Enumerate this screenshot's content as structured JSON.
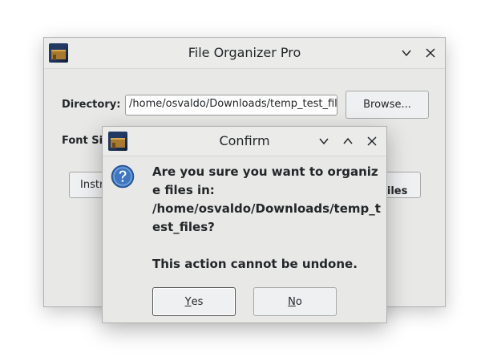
{
  "main_window": {
    "title": "File Organizer Pro",
    "directory_label": "Directory:",
    "directory_value": "/home/osvaldo/Downloads/temp_test_files",
    "browse_label": "Browse...",
    "font_size_label": "Font Siz",
    "instructions_label": "Instr",
    "organize_label": "e Files"
  },
  "dialog": {
    "title": "Confirm",
    "message": "Are you sure you want to organize files in:\n/home/osvaldo/Downloads/temp_test_files?\n\nThis action cannot be undone.",
    "yes_mnemonic": "Y",
    "yes_rest": "es",
    "no_mnemonic": "N",
    "no_rest": "o"
  },
  "icons": {
    "app": "app-icon",
    "question": "question-icon",
    "minimize": "chevron-down-icon",
    "maximize": "chevron-up-icon",
    "close": "close-icon"
  },
  "colors": {
    "window_bg": "#e8e8e7",
    "question_icon": "#3f78c0"
  }
}
